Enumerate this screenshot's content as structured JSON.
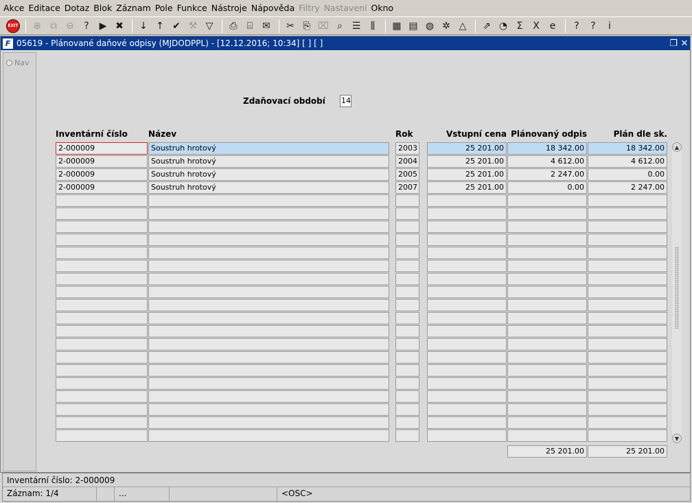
{
  "menu": [
    "Akce",
    "Editace",
    "Dotaz",
    "Blok",
    "Záznam",
    "Pole",
    "Funkce",
    "Nástroje",
    "Nápověda",
    "Filtry",
    "Nastavení",
    "Okno"
  ],
  "menu_disabled": [
    "Filtry",
    "Nastavení"
  ],
  "toolbar": {
    "exit_label": "EXIT",
    "icons": [
      "insert-record-icon",
      "copy-record-icon",
      "delete-record-icon",
      "enter-query-icon",
      "execute-query-icon",
      "cancel-query-icon",
      "sort-asc-icon",
      "sort-desc-icon",
      "commit-icon",
      "tools-icon",
      "filter-icon",
      "print-icon",
      "print-setup-icon",
      "mail-icon",
      "cut-icon",
      "copy-icon",
      "paste-icon",
      "find-icon",
      "list-icon",
      "columns-icon",
      "calendar-icon",
      "calculator-icon",
      "globe-icon",
      "settings-wheel-icon",
      "chart-icon",
      "export-icon",
      "graph-icon",
      "sum-icon",
      "excel-icon",
      "web-icon",
      "help-icon",
      "context-help-icon",
      "info-icon"
    ]
  },
  "window": {
    "title": "05619 - Plánované daňové odpisy (MJDODPPL) - [12.12.2016; 10:34]  [ ]  [ ]",
    "logo": "F"
  },
  "nav": {
    "label": "Nav"
  },
  "form": {
    "period_label": "Zdaňovací období",
    "period_value": "14"
  },
  "table": {
    "headers": {
      "inv": "Inventární číslo",
      "name": "Název",
      "year": "Rok",
      "price": "Vstupní cena",
      "planned": "Plánovaný odpis",
      "plan_sk": "Plán dle sk."
    },
    "rows": [
      {
        "inv": "2-000009",
        "name": "Soustruh hrotový",
        "year": "2003",
        "price": "25 201.00",
        "planned": "18 342.00",
        "plan_sk": "18 342.00"
      },
      {
        "inv": "2-000009",
        "name": "Soustruh hrotový",
        "year": "2004",
        "price": "25 201.00",
        "planned": "4 612.00",
        "plan_sk": "4 612.00"
      },
      {
        "inv": "2-000009",
        "name": "Soustruh hrotový",
        "year": "2005",
        "price": "25 201.00",
        "planned": "2 247.00",
        "plan_sk": "0.00"
      },
      {
        "inv": "2-000009",
        "name": "Soustruh hrotový",
        "year": "2007",
        "price": "25 201.00",
        "planned": "0.00",
        "plan_sk": "2 247.00"
      }
    ],
    "total_rows": 23,
    "totals": {
      "planned": "25 201.00",
      "plan_sk": "25 201.00"
    }
  },
  "status": {
    "line1": "Inventární číslo: 2-000009",
    "record": "Záznam: 1/4",
    "dots": "...",
    "mode": "<OSC>"
  }
}
